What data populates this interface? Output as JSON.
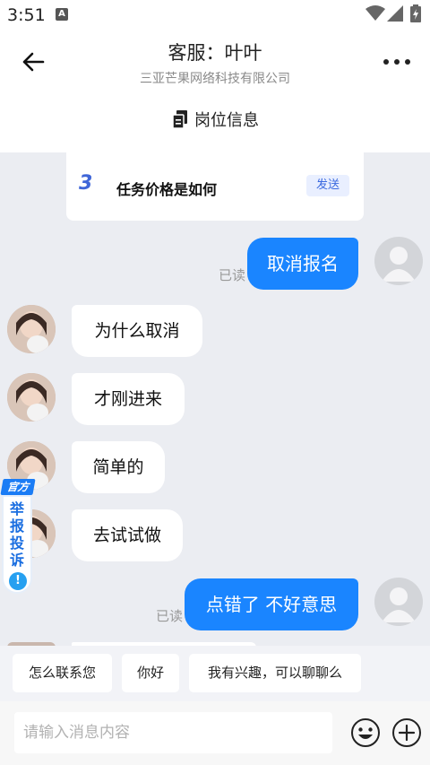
{
  "status_bar": {
    "time": "3:51",
    "notification_icon": "A"
  },
  "header": {
    "title": "客服：叶叶",
    "subtitle": "三亚芒果网络科技有限公司",
    "job_info_label": "岗位信息"
  },
  "question_card": {
    "number": "3",
    "text": "任务价格是如何",
    "send_label": "发送"
  },
  "messages": [
    {
      "from": "me",
      "text": "取消报名",
      "read_label": "已读"
    },
    {
      "from": "other",
      "text": "为什么取消"
    },
    {
      "from": "other",
      "text": "才刚进来"
    },
    {
      "from": "other",
      "text": "简单的"
    },
    {
      "from": "other",
      "text": "去试试做"
    },
    {
      "from": "me",
      "text": "点错了 不好意思",
      "read_label": "已读"
    }
  ],
  "report_badge": {
    "tag": "官方",
    "label": "举报投诉",
    "icon": "exclamation-icon"
  },
  "quick_replies": [
    "怎么联系您",
    "你好",
    "我有兴趣，可以聊聊么"
  ],
  "input": {
    "placeholder": "请输入消息内容"
  },
  "colors": {
    "accent": "#1a85ff",
    "background": "#ebedf2",
    "send_tag": "#3b6ae0"
  }
}
